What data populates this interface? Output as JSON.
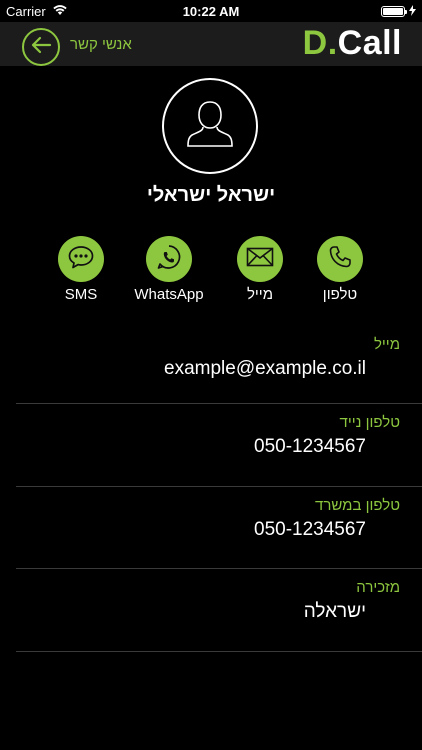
{
  "status": {
    "carrier": "Carrier",
    "time": "10:22 AM"
  },
  "header": {
    "back_label": "אנשי קשר",
    "brand_d": "D.",
    "brand_call": "Call",
    "accent": "#8dc63f"
  },
  "contact": {
    "name": "ישראל ישראלי"
  },
  "actions": [
    {
      "label": "טלפון",
      "icon": "phone-icon"
    },
    {
      "label": "מייל",
      "icon": "mail-icon"
    },
    {
      "label": "WhatsApp",
      "icon": "whatsapp-icon"
    },
    {
      "label": "SMS",
      "icon": "sms-icon"
    }
  ],
  "fields": [
    {
      "label": "מייל",
      "value": "example@example.co.il"
    },
    {
      "label": "טלפון נייד",
      "value": "050-1234567"
    },
    {
      "label": "טלפון במשרד",
      "value": "050-1234567"
    },
    {
      "label": "מזכירה",
      "value": "ישראלה"
    }
  ]
}
